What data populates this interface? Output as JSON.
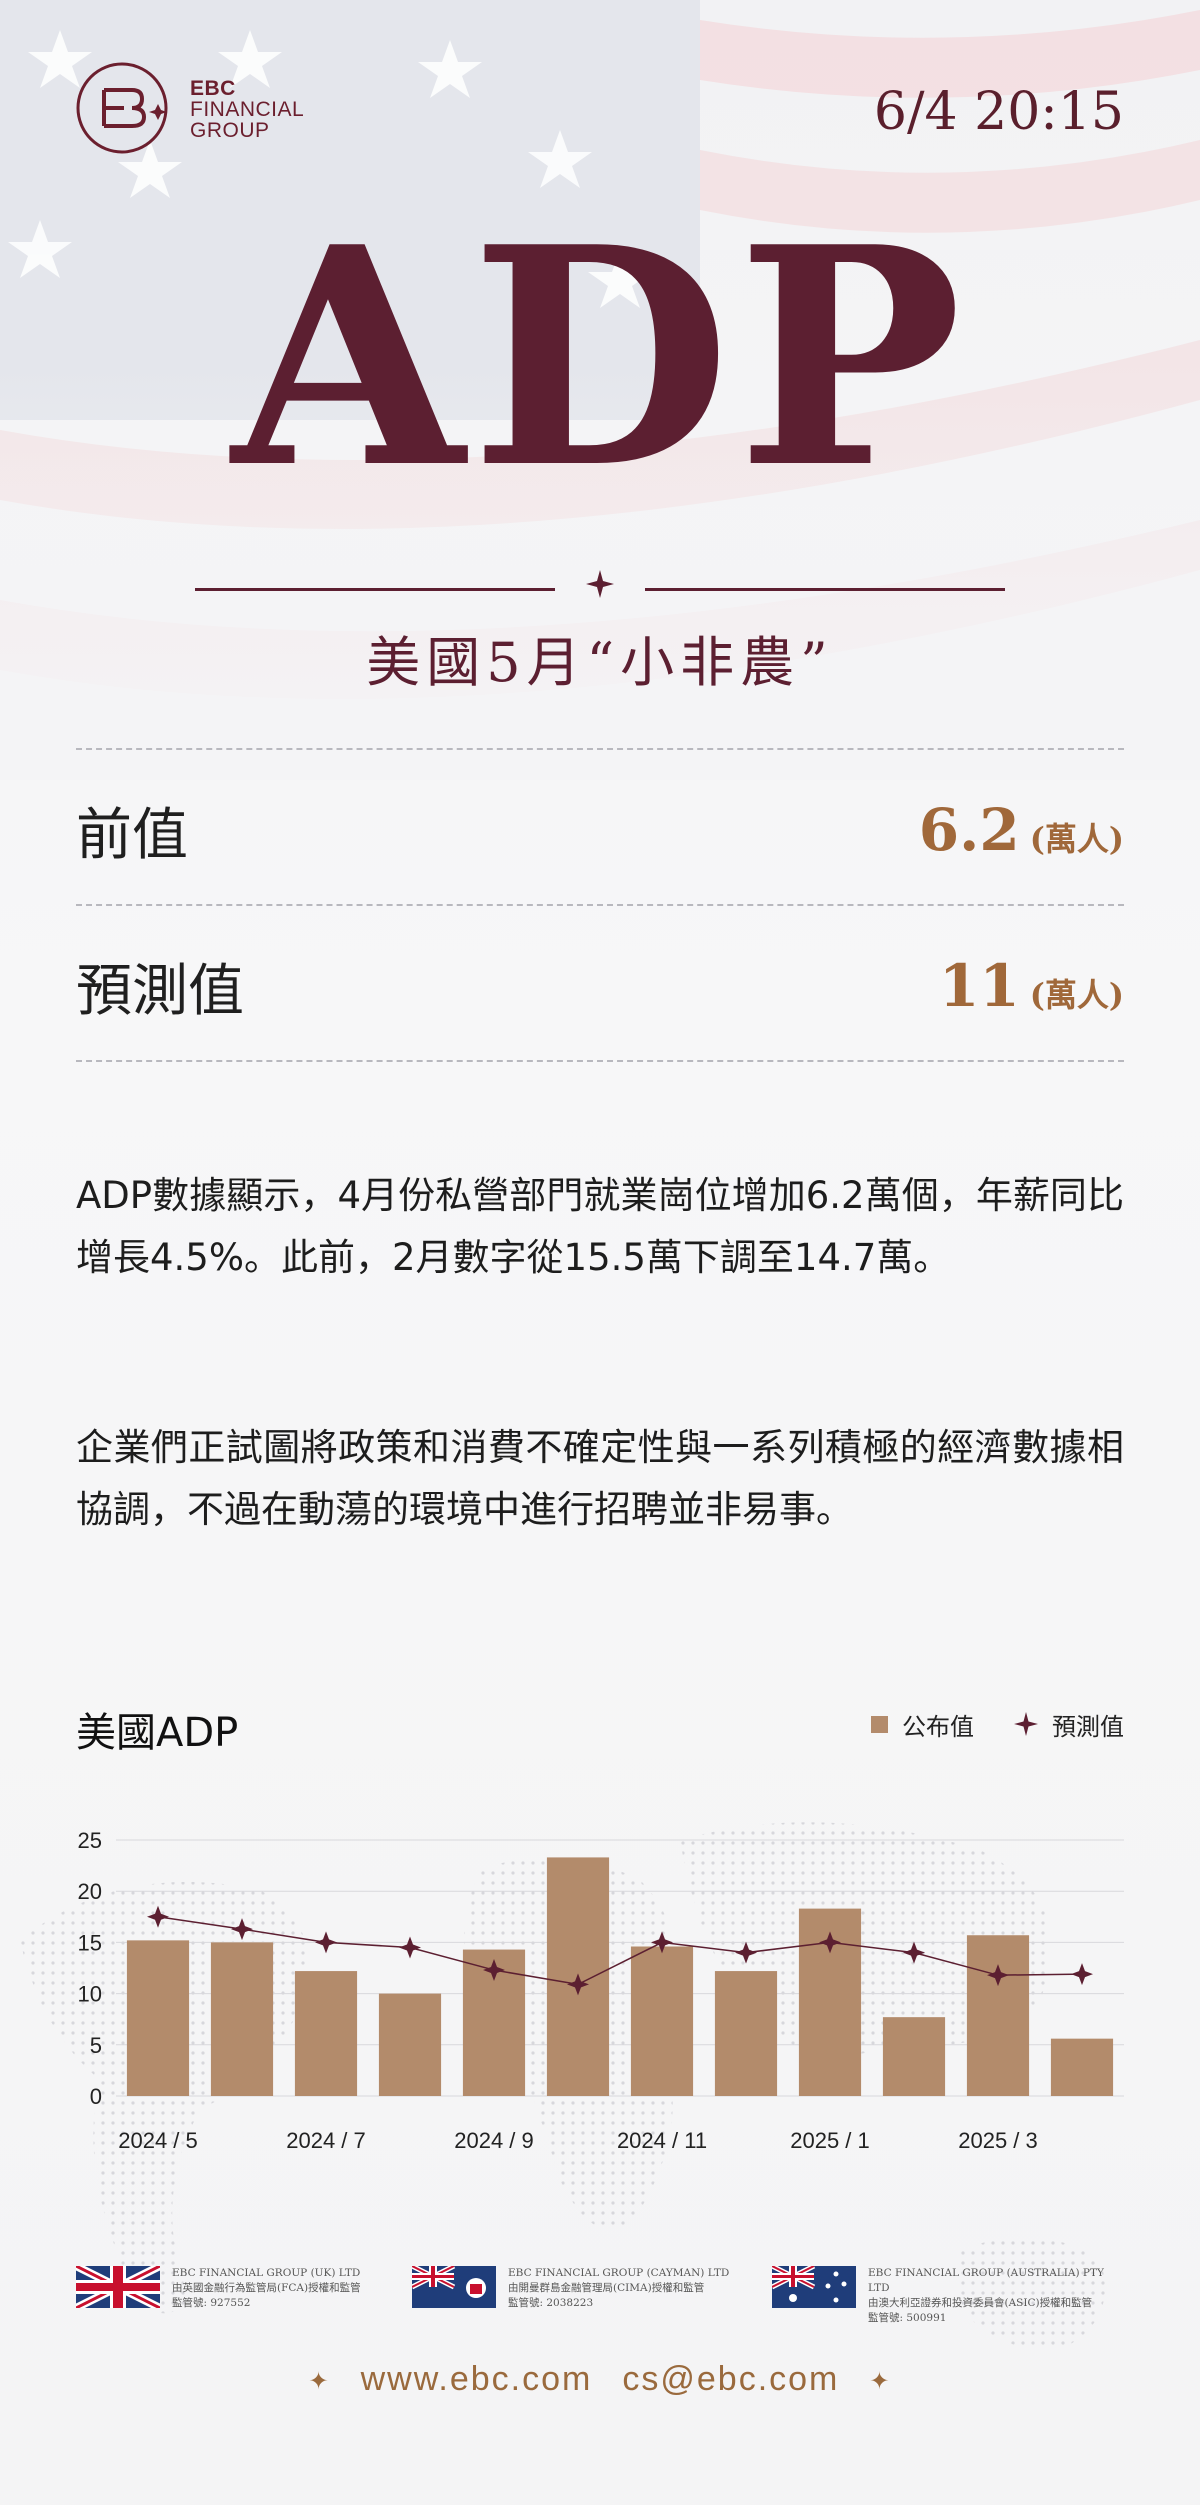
{
  "header": {
    "brand_line1": "EBC",
    "brand_line2": "FINANCIAL",
    "brand_line3": "GROUP",
    "datetime": "6/4 20:15",
    "title": "ADP",
    "subtitle": "美國5月“小非農”"
  },
  "stats": [
    {
      "label": "前值",
      "value": "6.2",
      "unit": "(萬人)"
    },
    {
      "label": "預測值",
      "value": "11",
      "unit": "(萬人)"
    }
  ],
  "body": {
    "para1": "ADP數據顯示，4月份私營部門就業崗位增加6.2萬個，年薪同比增長4.5%。此前，2月數字從15.5萬下調至14.7萬。",
    "para2": "企業們正試圖將政策和消費不確定性與一系列積極的經濟數據相協調，不過在動蕩的環境中進行招聘並非易事。"
  },
  "chart_section": {
    "title": "美國ADP",
    "legend_actual": "公布值",
    "legend_forecast": "預測值"
  },
  "chart_data": {
    "type": "bar",
    "categories": [
      "2024/5",
      "2024/6",
      "2024/7",
      "2024/8",
      "2024/9",
      "2024/10",
      "2024/11",
      "2024/12",
      "2025/1",
      "2025/2",
      "2025/3",
      "2025/4"
    ],
    "x_tick_labels": [
      "2024 / 5",
      "2024 / 7",
      "2024 / 9",
      "2024 / 11",
      "2025 / 1",
      "2025 / 3"
    ],
    "series": [
      {
        "name": "公布值",
        "type": "bar",
        "color": "#b38b6b",
        "values": [
          15.2,
          15.0,
          12.2,
          10.0,
          14.3,
          23.3,
          14.6,
          12.2,
          18.3,
          7.7,
          15.7,
          5.6
        ]
      },
      {
        "name": "預測值",
        "type": "line",
        "color": "#5c1f31",
        "values": [
          17.5,
          16.3,
          15.0,
          14.5,
          12.3,
          10.9,
          15.0,
          14.0,
          15.0,
          14.0,
          11.8,
          11.9
        ]
      }
    ],
    "yticks": [
      0,
      5,
      10,
      15,
      20,
      25
    ],
    "ylim": [
      0,
      25
    ],
    "grid": true
  },
  "footer": {
    "entities": [
      {
        "line1": "EBC FINANCIAL GROUP (UK) LTD",
        "line2": "由英國金融行為監管局(FCA)授權和監管",
        "line3": "監管號: 927552",
        "flag_icon": "uk-flag-icon"
      },
      {
        "line1": "EBC FINANCIAL GROUP (CAYMAN) LTD",
        "line2": "由開曼群島金融管理局(CIMA)授權和監管",
        "line3": "監管號: 2038223",
        "flag_icon": "cayman-flag-icon"
      },
      {
        "line1": "EBC FINANCIAL GROUP (AUSTRALIA) PTY LTD",
        "line2": "由澳大利亞證券和投資委員會(ASIC)授權和監管",
        "line3": "監管號: 500991",
        "flag_icon": "australia-flag-icon"
      }
    ],
    "website": "www.ebc.com",
    "email": "cs@ebc.com"
  },
  "colors": {
    "brand": "#5c1f31",
    "accent_gold": "#a0683a",
    "bar": "#b38b6b"
  }
}
